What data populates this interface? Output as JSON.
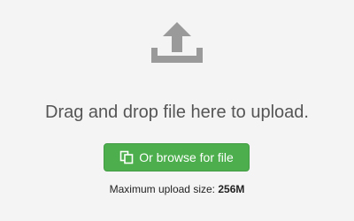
{
  "upload": {
    "icon": "upload-tray-icon",
    "message": "Drag and drop file here to upload.",
    "browse_button": {
      "icon": "files-icon",
      "label": "Or browse for file"
    },
    "limit_label": "Maximum upload size:",
    "limit_value": "256M"
  },
  "colors": {
    "background": "#f4f4f4",
    "icon": "#9a9a9a",
    "message_text": "#555555",
    "button_background": "#4cae4c",
    "button_text": "#ffffff"
  }
}
